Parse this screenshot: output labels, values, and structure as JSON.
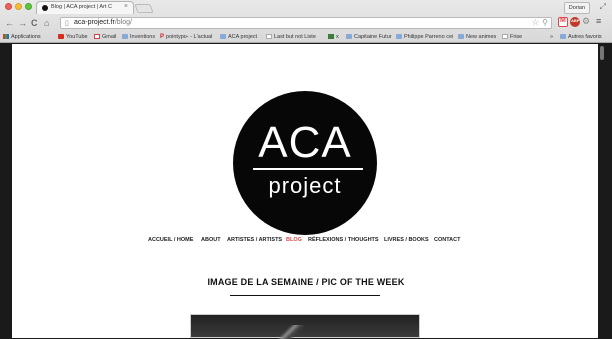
{
  "browser": {
    "tab_title": "Blog | ACA project | Art C",
    "tab_close": "×",
    "user_label": "Dorian",
    "url_host": "aca-project.fr",
    "url_path": "/blog/",
    "nav_icons": {
      "back": "←",
      "forward": "→",
      "reload": "C",
      "home": "⌂"
    },
    "bookmarks": [
      {
        "label": "Applications",
        "icon": "apps-grid-icon"
      },
      {
        "label": "YouTube",
        "icon": "youtube-icon"
      },
      {
        "label": "Gmail",
        "icon": "gmail-icon"
      },
      {
        "label": "Inventions",
        "icon": "folder-icon"
      },
      {
        "label": "pointypo- - L'actual",
        "icon": "pinterest-icon"
      },
      {
        "label": "ACA project",
        "icon": "folder-icon"
      },
      {
        "label": "Last but not Liste",
        "icon": "page-icon"
      },
      {
        "label": "x",
        "icon": "green-square-icon"
      },
      {
        "label": "Capitaine Futur",
        "icon": "folder-icon"
      },
      {
        "label": "Philippe Parreno cei",
        "icon": "folder-icon"
      },
      {
        "label": "New animes",
        "icon": "folder-icon"
      },
      {
        "label": "Frise",
        "icon": "page-icon"
      },
      {
        "label": "Autres favoris",
        "icon": "folder-icon"
      }
    ],
    "bookmarks_overflow": "»"
  },
  "site": {
    "logo_top": "ACA",
    "logo_bottom": "project",
    "menu": [
      {
        "label": "ACCUEIL / HOME",
        "active": false
      },
      {
        "label": "ABOUT",
        "active": false
      },
      {
        "label": "ARTISTES / ARTISTS",
        "active": false
      },
      {
        "label": "BLOG",
        "active": true
      },
      {
        "label": "RÉFLEXIONS / THOUGHTS",
        "active": false
      },
      {
        "label": "LIVRES / BOOKS",
        "active": false
      },
      {
        "label": "CONTACT",
        "active": false
      }
    ],
    "section_heading": "IMAGE DE LA SEMAINE / PIC OF THE WEEK"
  },
  "colors": {
    "accent_active_menu": "#d94a4a",
    "logo_bg": "#070707"
  }
}
